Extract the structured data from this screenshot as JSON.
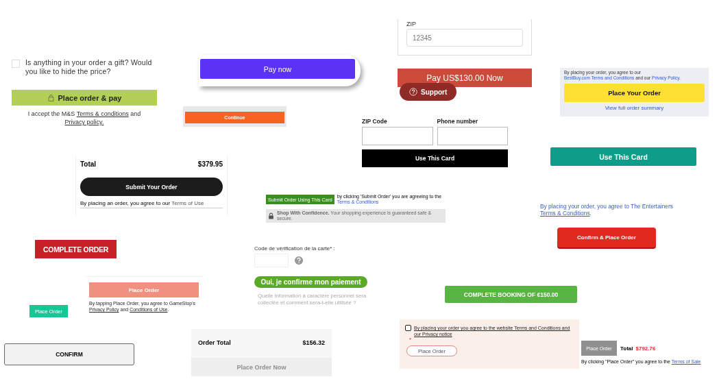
{
  "snippets": [
    {
      "kind": "gift",
      "checked": false,
      "question": "Is anything in your order a gift? Would you like to hide the price?",
      "button": "Place order & pay",
      "legal": [
        {
          "text": "I accept the M&S ",
          "link": false
        },
        {
          "text": "Terms & conditions",
          "link": true
        },
        {
          "text": " and ",
          "link": false
        },
        {
          "text": "Privacy policy.",
          "link": true
        }
      ]
    },
    {
      "kind": "pay_now",
      "button": "Pay now"
    },
    {
      "kind": "continue",
      "button": "Continue"
    },
    {
      "kind": "zip_pay",
      "label": "ZIP",
      "placeholder": "12345",
      "button": "Pay US$130.00 Now",
      "support": "Support"
    },
    {
      "kind": "bestbuy",
      "legal": [
        {
          "text": "By placing your order, you agree to our ",
          "link": false
        },
        {
          "text": "BestBuy.com Terms and Conditions",
          "link": true
        },
        {
          "text": " and our ",
          "link": false
        },
        {
          "text": "Privacy Policy",
          "link": true
        },
        {
          "text": ".",
          "link": false
        }
      ],
      "button": "Place Your Order",
      "summary_link": "View full order summary"
    },
    {
      "kind": "card_form",
      "fields": [
        {
          "label": "ZIP Code"
        },
        {
          "label": "Phone number"
        }
      ],
      "button": "Use This Card"
    },
    {
      "kind": "teal_button",
      "button": "Use This Card"
    },
    {
      "kind": "total_submit",
      "label": "Total",
      "amount": "$379.95",
      "button": "Submit Your Order",
      "legal": [
        {
          "text": "By placing an order, you agree to our ",
          "link": false
        },
        {
          "text": "Terms of Use",
          "link": true
        }
      ]
    },
    {
      "kind": "submit_card",
      "button": "Submit Order Using This Card",
      "legal": [
        {
          "text": "by clicking 'Submit Order' you are agreeing to the ",
          "link": false
        },
        {
          "text": "Terms & Conditions",
          "link": true
        }
      ],
      "notice": "**Shop With Confidence.** Your shopping experience is guaranteed safe & secure."
    },
    {
      "kind": "entertainer",
      "legal": [
        {
          "text": "By placing your order, you agree to The Entertainers ",
          "link": false
        },
        {
          "text": "Terms & Conditions",
          "link": true
        },
        {
          "text": ".",
          "link": false
        }
      ],
      "button": "Confirm & Place Order"
    },
    {
      "kind": "red_block",
      "button": "COMPLETE ORDER"
    },
    {
      "kind": "small_green",
      "button": "Place Order"
    },
    {
      "kind": "gamestop",
      "button": "Place Order",
      "disabled": true,
      "legal": [
        {
          "text": "By tapping Place Order, you agree to GameStop's ",
          "link": false
        },
        {
          "text": "Privacy Policy",
          "link": true
        },
        {
          "text": " and ",
          "link": false
        },
        {
          "text": "Conditions of Use",
          "link": true
        },
        {
          "text": ".",
          "link": false
        }
      ]
    },
    {
      "kind": "cvv",
      "label": "Code de vérification de la carte* :",
      "button": "Oui, je confirme mon paiement",
      "note": "Quelle information à caractère personnel sera collectée et comment sera-t-elle utilisée ?"
    },
    {
      "kind": "green_wide",
      "button": "COMPLETE BOOKING OF €150.00"
    },
    {
      "kind": "outline_confirm",
      "button": "CONFIRM"
    },
    {
      "kind": "order_total",
      "label": "Order Total",
      "amount": "$156.32",
      "button": "Place Order Now",
      "disabled": true
    },
    {
      "kind": "agree_check",
      "checked": false,
      "agreement": "By placing your order you agree to the website Terms and Conditions and our Privacy notice",
      "required": "*",
      "button": "Place Order"
    },
    {
      "kind": "sale_total",
      "button": "Place Order",
      "disabled": true,
      "label": "Total",
      "amount": "$792.76",
      "legal": [
        {
          "text": "By clicking \"Place Order\" you agree to the ",
          "link": false
        },
        {
          "text": "Terms of Sale",
          "link": true
        }
      ]
    }
  ]
}
